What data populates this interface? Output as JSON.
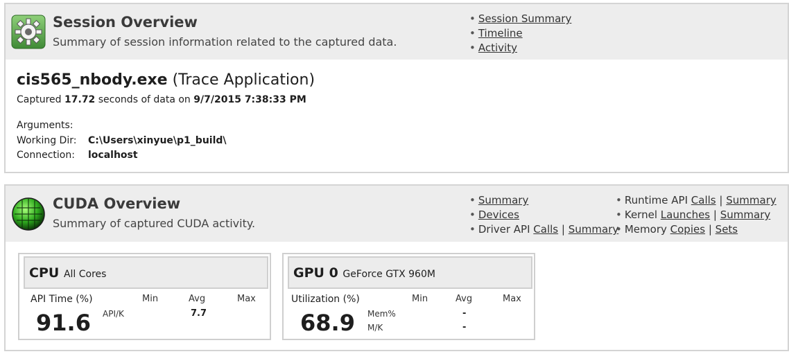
{
  "session": {
    "title": "Session Overview",
    "subtitle": "Summary of session information related to the captured data.",
    "links": [
      "Session Summary",
      "Timeline",
      "Activity"
    ],
    "app_name": "cis565_nbody.exe",
    "app_type": "(Trace Application)",
    "captured_prefix": "Captured",
    "captured_seconds": "17.72",
    "captured_mid": "seconds of data on",
    "captured_datetime": "9/7/2015 7:38:33 PM",
    "arguments_label": "Arguments:",
    "arguments_value": "",
    "working_dir_label": "Working Dir:",
    "working_dir_value": "C:\\Users\\xinyue\\p1_build\\",
    "connection_label": "Connection:",
    "connection_value": "localhost"
  },
  "cuda": {
    "title": "CUDA Overview",
    "subtitle": "Summary of captured CUDA activity.",
    "links_col1": {
      "summary": "Summary",
      "devices": "Devices",
      "driver_prefix": "Driver API",
      "driver_calls": "Calls",
      "driver_summary": "Summary"
    },
    "links_col2": {
      "runtime_prefix": "Runtime API",
      "runtime_calls": "Calls",
      "runtime_summary": "Summary",
      "kernel_prefix": "Kernel",
      "kernel_launches": "Launches",
      "kernel_summary": "Summary",
      "memory_prefix": "Memory",
      "memory_copies": "Copies",
      "memory_sets": "Sets"
    },
    "separator": "|"
  },
  "cpu_card": {
    "title": "CPU",
    "subtitle": "All Cores",
    "metric": "API Time (%)",
    "value": "91.6",
    "col_min": "Min",
    "col_avg": "Avg",
    "col_max": "Max",
    "row_label": "API/K",
    "row_avg": "7.7"
  },
  "gpu_card": {
    "title": "GPU 0",
    "subtitle": "GeForce GTX 960M",
    "metric": "Utilization (%)",
    "value": "68.9",
    "col_min": "Min",
    "col_avg": "Avg",
    "col_max": "Max",
    "row1_label": "Mem%",
    "row1_avg": "-",
    "row2_label": "M/K",
    "row2_avg": "-"
  },
  "icons": {
    "session_logo": "gear-icon",
    "cuda_logo": "cuda-logo-icon"
  },
  "colors": {
    "header_bg": "#ededed",
    "border": "#d4d4d4",
    "cuda_green": "#3ccf2a"
  }
}
